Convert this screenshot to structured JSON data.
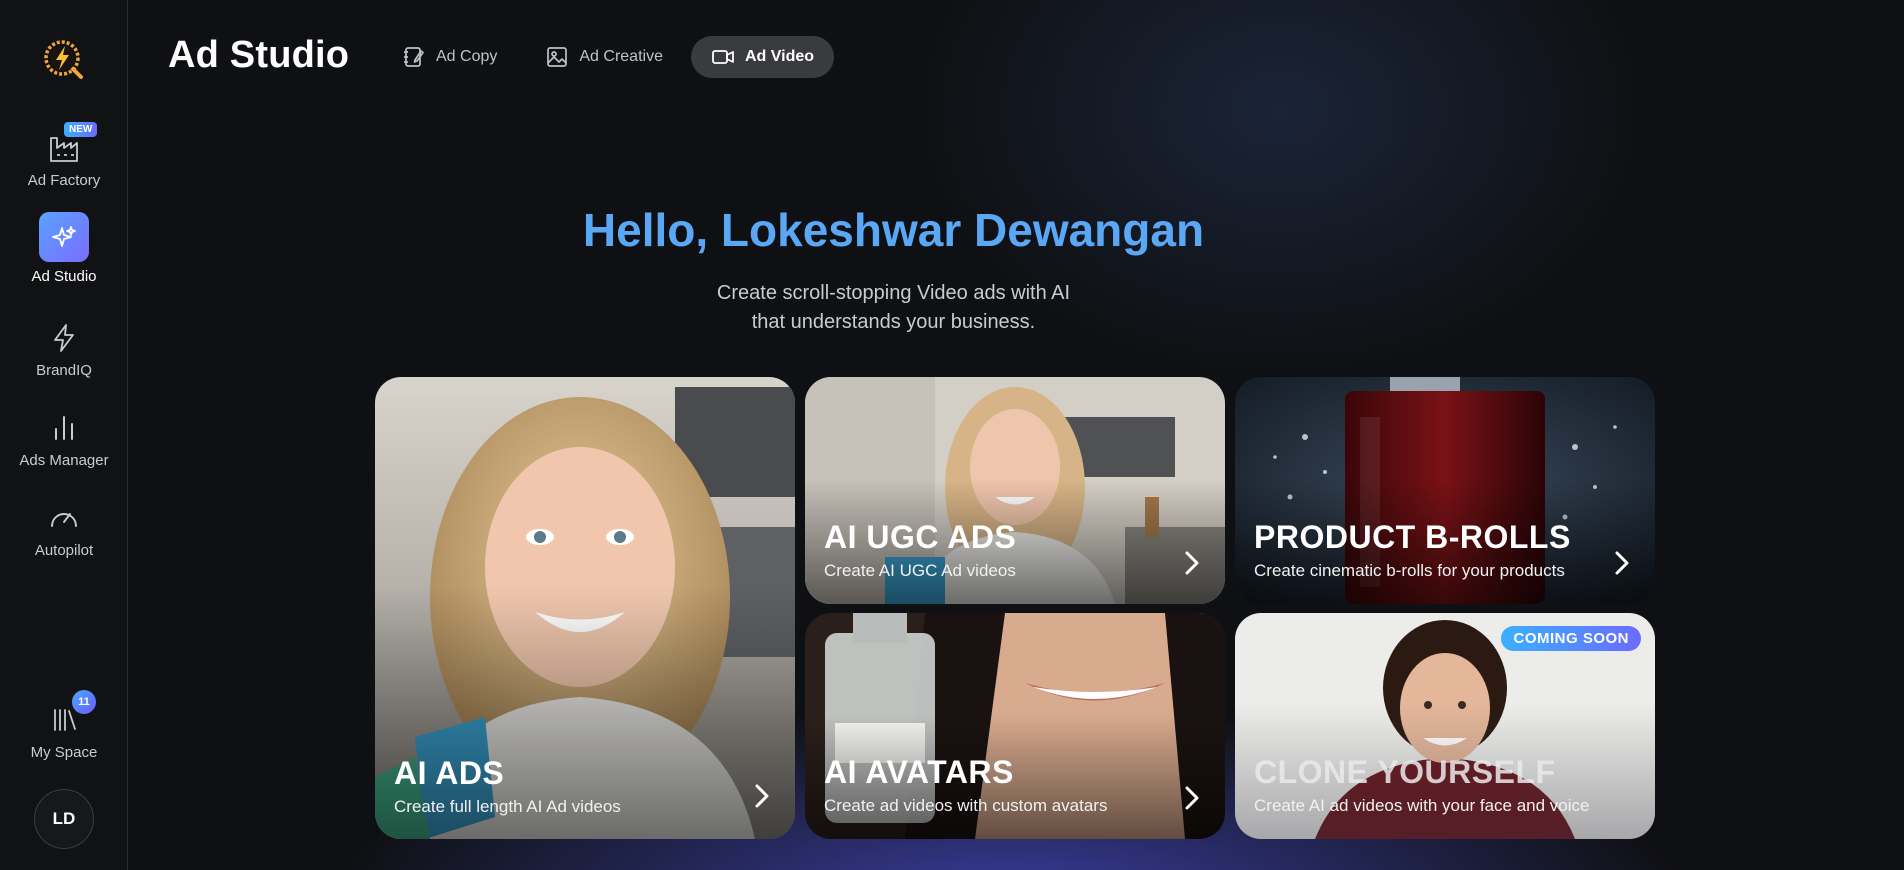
{
  "app": {
    "title": "Ad Studio"
  },
  "sidebar": {
    "items": [
      {
        "label": "Ad Factory",
        "icon": "factory-icon",
        "badge": "NEW"
      },
      {
        "label": "Ad Studio",
        "icon": "sparkle-icon",
        "active": true
      },
      {
        "label": "BrandIQ",
        "icon": "lightning-icon"
      },
      {
        "label": "Ads Manager",
        "icon": "bar-chart-icon"
      },
      {
        "label": "Autopilot",
        "icon": "gauge-icon"
      }
    ],
    "my_space": {
      "label": "My Space",
      "icon": "library-icon",
      "count": "11"
    },
    "avatar": "LD"
  },
  "tabs": [
    {
      "label": "Ad Copy",
      "icon": "notebook-pen-icon"
    },
    {
      "label": "Ad Creative",
      "icon": "image-icon"
    },
    {
      "label": "Ad Video",
      "icon": "video-camera-icon",
      "active": true
    }
  ],
  "hero": {
    "greeting": "Hello, Lokeshwar Dewangan",
    "subtitle_line1": "Create scroll-stopping Video ads with AI",
    "subtitle_line2": "that understands your business."
  },
  "cards": [
    {
      "title": "AI ADS",
      "desc": "Create full length AI Ad videos"
    },
    {
      "title": "AI UGC ADS",
      "desc": "Create AI UGC Ad videos"
    },
    {
      "title": "PRODUCT B-ROLLS",
      "desc": "Create cinematic b-rolls for your products"
    },
    {
      "title": "AI AVATARS",
      "desc": "Create ad videos with custom avatars"
    },
    {
      "title": "CLONE YOURSELF",
      "desc": "Create AI ad videos with your face and voice",
      "badge": "COMING SOON"
    }
  ],
  "colors": {
    "accent": "#5aa8f5",
    "active_tab": "#3a3b3f",
    "gradient_start": "#3bb0ff",
    "gradient_end": "#6b6bff"
  }
}
